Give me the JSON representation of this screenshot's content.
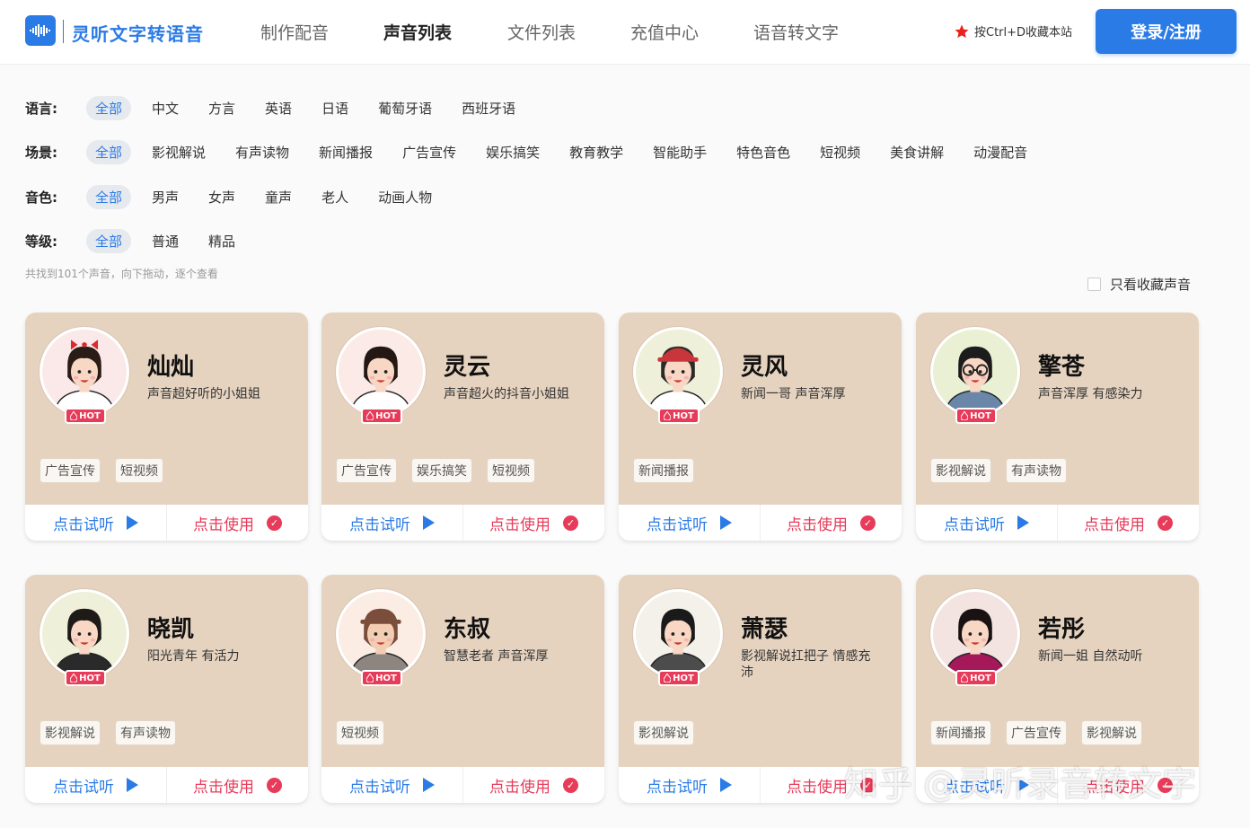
{
  "header": {
    "logo_text": "灵听文字转语音",
    "nav": [
      "制作配音",
      "声音列表",
      "文件列表",
      "充值中心",
      "语音转文字"
    ],
    "favorite_hint": "按Ctrl+D收藏本站",
    "login_label": "登录/注册"
  },
  "filters": {
    "language": {
      "label": "语言:",
      "options": [
        "全部",
        "中文",
        "方言",
        "英语",
        "日语",
        "葡萄牙语",
        "西班牙语"
      ],
      "selected": "全部"
    },
    "scene": {
      "label": "场景:",
      "options": [
        "全部",
        "影视解说",
        "有声读物",
        "新闻播报",
        "广告宣传",
        "娱乐搞笑",
        "教育教学",
        "智能助手",
        "特色音色",
        "短视频",
        "美食讲解",
        "动漫配音"
      ],
      "selected": "全部"
    },
    "timbre": {
      "label": "音色:",
      "options": [
        "全部",
        "男声",
        "女声",
        "童声",
        "老人",
        "动画人物"
      ],
      "selected": "全部"
    },
    "grade": {
      "label": "等级:",
      "options": [
        "全部",
        "普通",
        "精品"
      ],
      "selected": "全部"
    }
  },
  "found_text": "共找到101个声音，向下拖动，逐个查看",
  "favorites_only_label": "只看收藏声音",
  "card_actions": {
    "listen": "点击试听",
    "use": "点击使用",
    "hot": "HOT"
  },
  "voices": [
    {
      "name": "灿灿",
      "desc": "声音超好听的小姐姐",
      "tags": [
        "广告宣传",
        "短视频"
      ]
    },
    {
      "name": "灵云",
      "desc": "声音超火的抖音小姐姐",
      "tags": [
        "广告宣传",
        "娱乐搞笑",
        "短视频"
      ]
    },
    {
      "name": "灵风",
      "desc": "新闻一哥 声音浑厚",
      "tags": [
        "新闻播报"
      ]
    },
    {
      "name": "擎苍",
      "desc": "声音浑厚 有感染力",
      "tags": [
        "影视解说",
        "有声读物"
      ]
    },
    {
      "name": "晓凯",
      "desc": "阳光青年 有活力",
      "tags": [
        "影视解说",
        "有声读物"
      ]
    },
    {
      "name": "东叔",
      "desc": "智慧老者 声音浑厚",
      "tags": [
        "短视频"
      ]
    },
    {
      "name": "萧瑟",
      "desc": "影视解说扛把子 情感充沛",
      "tags": [
        "影视解说"
      ]
    },
    {
      "name": "若彤",
      "desc": "新闻一姐 自然动听",
      "tags": [
        "新闻播报",
        "广告宣传",
        "影视解说"
      ]
    }
  ],
  "watermark": "知乎 @灵听录音转文字",
  "colors": {
    "brand": "#2b7be6",
    "accent": "#e83a59",
    "card_bg": "#e6d3bf"
  }
}
